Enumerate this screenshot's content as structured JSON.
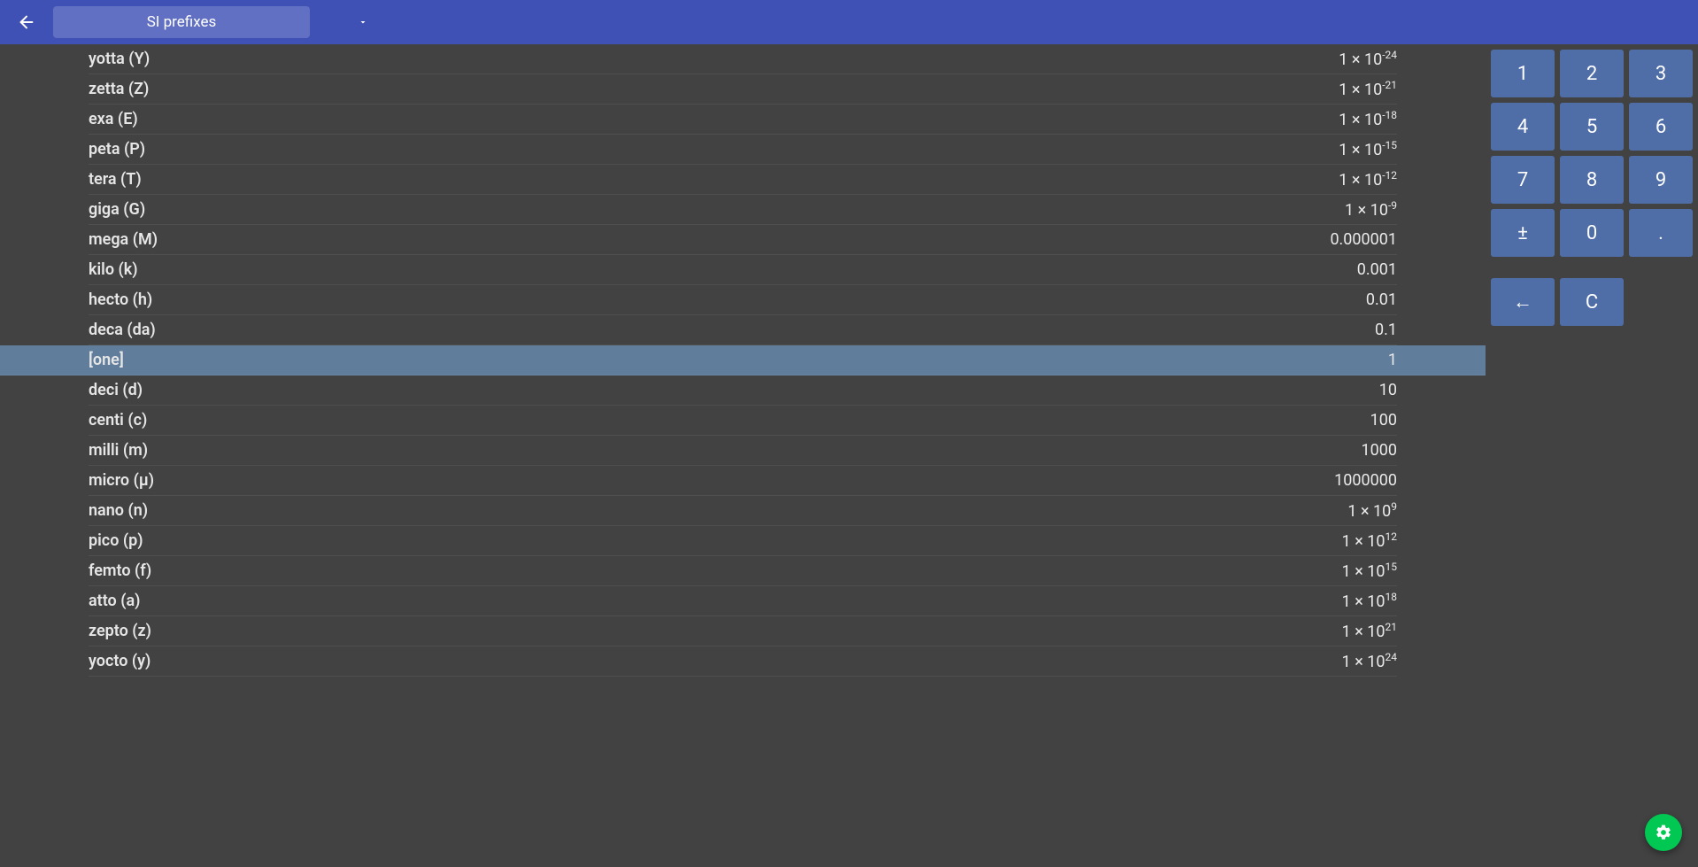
{
  "header": {
    "title": "SI prefixes"
  },
  "rows": [
    {
      "label": "yotta (Y)",
      "base": "1 × 10",
      "exp": "-24",
      "selected": false
    },
    {
      "label": "zetta (Z)",
      "base": "1 × 10",
      "exp": "-21",
      "selected": false
    },
    {
      "label": "exa (E)",
      "base": "1 × 10",
      "exp": "-18",
      "selected": false
    },
    {
      "label": "peta (P)",
      "base": "1 × 10",
      "exp": "-15",
      "selected": false
    },
    {
      "label": "tera (T)",
      "base": "1 × 10",
      "exp": "-12",
      "selected": false
    },
    {
      "label": "giga (G)",
      "base": "1 × 10",
      "exp": "-9",
      "selected": false
    },
    {
      "label": "mega (M)",
      "base": "0.000001",
      "exp": "",
      "selected": false
    },
    {
      "label": "kilo (k)",
      "base": "0.001",
      "exp": "",
      "selected": false
    },
    {
      "label": "hecto (h)",
      "base": "0.01",
      "exp": "",
      "selected": false
    },
    {
      "label": "deca (da)",
      "base": "0.1",
      "exp": "",
      "selected": false
    },
    {
      "label": "[one]",
      "base": "1",
      "exp": "",
      "selected": true
    },
    {
      "label": "deci (d)",
      "base": "10",
      "exp": "",
      "selected": false
    },
    {
      "label": "centi (c)",
      "base": "100",
      "exp": "",
      "selected": false
    },
    {
      "label": "milli (m)",
      "base": "1000",
      "exp": "",
      "selected": false
    },
    {
      "label": "micro (μ)",
      "base": "1000000",
      "exp": "",
      "selected": false
    },
    {
      "label": "nano (n)",
      "base": "1 × 10",
      "exp": "9",
      "selected": false
    },
    {
      "label": "pico (p)",
      "base": "1 × 10",
      "exp": "12",
      "selected": false
    },
    {
      "label": "femto (f)",
      "base": "1 × 10",
      "exp": "15",
      "selected": false
    },
    {
      "label": "atto (a)",
      "base": "1 × 10",
      "exp": "18",
      "selected": false
    },
    {
      "label": "zepto (z)",
      "base": "1 × 10",
      "exp": "21",
      "selected": false
    },
    {
      "label": "yocto (y)",
      "base": "1 × 10",
      "exp": "24",
      "selected": false
    }
  ],
  "keypad": {
    "r0": [
      "1",
      "2",
      "3"
    ],
    "r1": [
      "4",
      "5",
      "6"
    ],
    "r2": [
      "7",
      "8",
      "9"
    ],
    "r3": [
      "±",
      "0",
      "."
    ],
    "r4": [
      "←",
      "C"
    ]
  }
}
